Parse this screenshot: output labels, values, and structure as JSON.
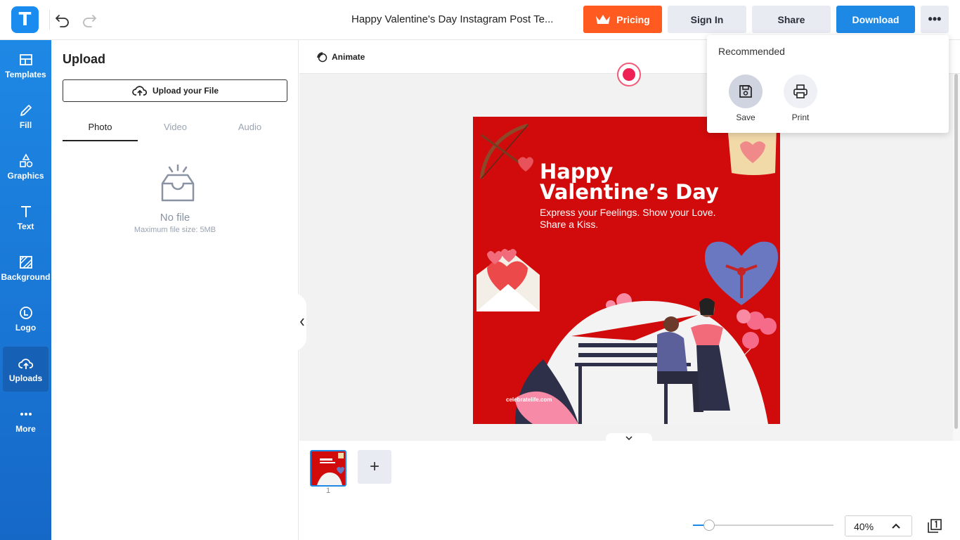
{
  "app": {
    "logo_letter": "T",
    "document_title": "Happy Valentine's Day Instagram Post Te..."
  },
  "header": {
    "pricing_label": "Pricing",
    "signin_label": "Sign In",
    "share_label": "Share",
    "download_label": "Download",
    "more_label": "•••"
  },
  "sidebar": {
    "items": [
      {
        "label": "Templates",
        "icon": "templates-icon"
      },
      {
        "label": "Fill",
        "icon": "pencil-icon"
      },
      {
        "label": "Graphics",
        "icon": "shapes-icon"
      },
      {
        "label": "Text",
        "icon": "text-icon"
      },
      {
        "label": "Background",
        "icon": "background-icon"
      },
      {
        "label": "Logo",
        "icon": "logo-icon"
      },
      {
        "label": "Uploads",
        "icon": "cloud-upload-icon"
      },
      {
        "label": "More",
        "icon": "more-icon"
      }
    ],
    "active": "Uploads"
  },
  "upload_panel": {
    "title": "Upload",
    "upload_button": "Upload your File",
    "tabs": [
      {
        "label": "Photo"
      },
      {
        "label": "Video"
      },
      {
        "label": "Audio"
      }
    ],
    "active_tab": "Photo",
    "empty_title": "No file",
    "empty_subtitle": "Maximum file size: 5MB"
  },
  "canvas": {
    "animate_label": "Animate"
  },
  "design": {
    "heading_line1": "Happy",
    "heading_line2": "Valentine’s Day",
    "subtitle_line1": "Express your Feelings. Show your Love.",
    "subtitle_line2": "Share a Kiss.",
    "website": "celebratelife.com",
    "colors": {
      "background": "#d10b0b",
      "pink": "#f56e93",
      "white": "#ffffff"
    }
  },
  "pages": {
    "current_page_number": "1",
    "add_page_label": "+"
  },
  "zoom": {
    "value_label": "40%",
    "slider_fraction": 0.11
  },
  "dropdown": {
    "title": "Recommended",
    "items": [
      {
        "label": "Save",
        "icon": "save-icon"
      },
      {
        "label": "Print",
        "icon": "print-icon"
      }
    ]
  },
  "colors": {
    "accent_blue": "#1e88e5",
    "pricing_orange": "#ff5a1f",
    "neutral_button": "#e8ebf2"
  }
}
